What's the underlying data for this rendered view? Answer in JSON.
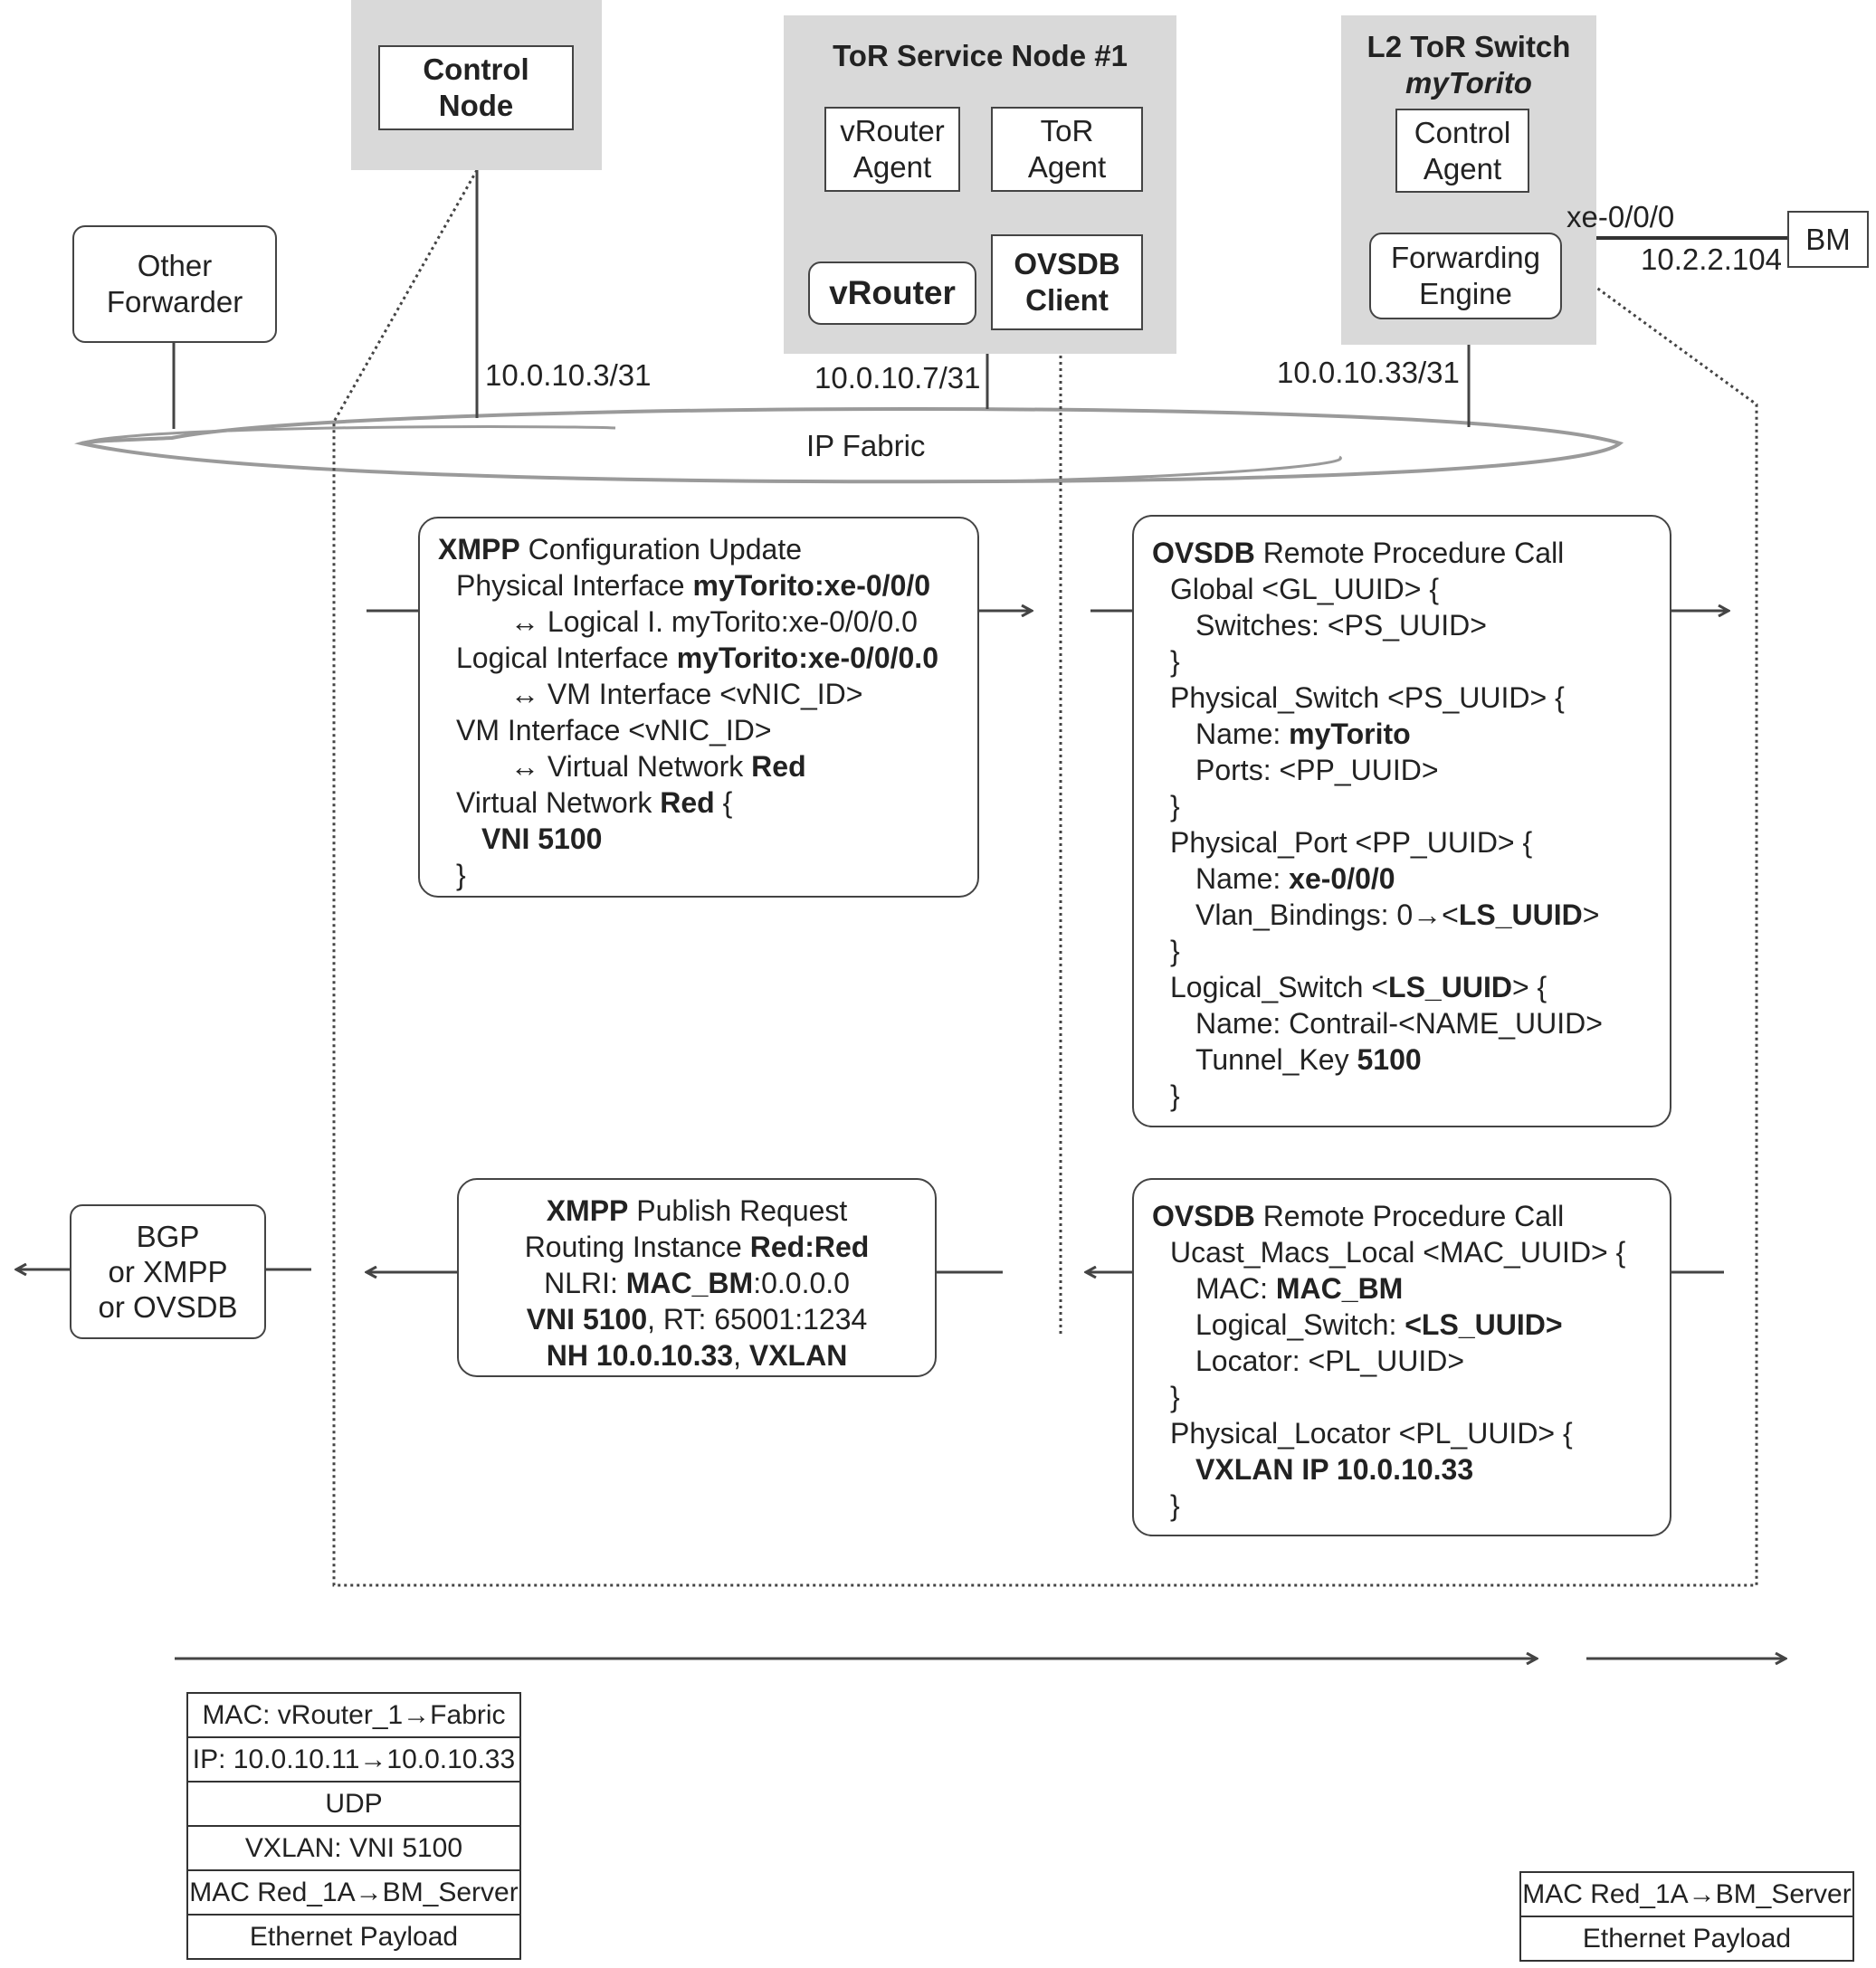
{
  "nodes": {
    "control_node": {
      "label_line1": "Control",
      "label_line2": "Node",
      "ip": "10.0.10.3/31"
    },
    "tor_service_node": {
      "title": "ToR Service Node #1",
      "vrouter_agent": {
        "line1": "vRouter",
        "line2": "Agent"
      },
      "tor_agent": {
        "line1": "ToR",
        "line2": "Agent"
      },
      "vrouter": "vRouter",
      "ovsdb_client": {
        "line1": "OVSDB",
        "line2": "Client"
      },
      "ip": "10.0.10.7/31"
    },
    "l2_tor_switch": {
      "title": "L2 ToR Switch",
      "subtitle": "myTorito",
      "control_agent": {
        "line1": "Control",
        "line2": "Agent"
      },
      "forwarding_engine": {
        "line1": "Forwarding",
        "line2": "Engine"
      },
      "ip": "10.0.10.33/31",
      "port": "xe-0/0/0"
    },
    "bm": {
      "label": "BM",
      "ip": "10.2.2.104"
    },
    "other_forwarder": {
      "line1": "Other",
      "line2": "Forwarder"
    },
    "ip_fabric": "IP Fabric",
    "bgp_box": {
      "line1": "BGP",
      "line2": "or XMPP",
      "line3": "or OVSDB"
    }
  },
  "messages": {
    "xmpp_config": {
      "header_bold": "XMPP",
      "header_rest": " Configuration Update",
      "lines": [
        {
          "indent": 1,
          "normal": "Physical Interface ",
          "bold": "myTorito:xe-0/0/0"
        },
        {
          "indent": 3,
          "normal": "↔ Logical I. myTorito:xe-0/0/0.0",
          "bold": ""
        },
        {
          "indent": 1,
          "normal": "Logical Interface ",
          "bold": "myTorito:xe-0/0/0.0"
        },
        {
          "indent": 3,
          "normal": "↔ VM Interface <vNIC_ID>",
          "bold": ""
        },
        {
          "indent": 1,
          "normal": "VM Interface <vNIC_ID>",
          "bold": ""
        },
        {
          "indent": 3,
          "normal": "↔ Virtual Network ",
          "bold": "Red"
        },
        {
          "indent": 1,
          "normal": "Virtual Network ",
          "bold": "Red",
          "after": " {"
        },
        {
          "indent": 2,
          "normal": "",
          "bold": "VNI 5100"
        },
        {
          "indent": 1,
          "normal": "}",
          "bold": ""
        }
      ]
    },
    "ovsdb_rpc_1": {
      "header_bold": "OVSDB",
      "header_rest": " Remote Procedure Call",
      "lines": [
        {
          "indent": 1,
          "normal": "Global <GL_UUID> {",
          "bold": ""
        },
        {
          "indent": 2,
          "normal": "Switches: <PS_UUID>",
          "bold": ""
        },
        {
          "indent": 1,
          "normal": "}",
          "bold": ""
        },
        {
          "indent": 1,
          "normal": "Physical_Switch <PS_UUID> {",
          "bold": ""
        },
        {
          "indent": 2,
          "normal": "Name: ",
          "bold": "myTorito"
        },
        {
          "indent": 2,
          "normal": "Ports: <PP_UUID>",
          "bold": ""
        },
        {
          "indent": 1,
          "normal": "}",
          "bold": ""
        },
        {
          "indent": 1,
          "normal": "Physical_Port <PP_UUID> {",
          "bold": ""
        },
        {
          "indent": 2,
          "normal": "Name: ",
          "bold": "xe-0/0/0"
        },
        {
          "indent": 2,
          "normal": "Vlan_Bindings: 0→<",
          "bold": "LS_UUID",
          "after": ">"
        },
        {
          "indent": 1,
          "normal": "}",
          "bold": ""
        },
        {
          "indent": 1,
          "normal": "Logical_Switch <",
          "bold": "LS_UUID",
          "after": "> {"
        },
        {
          "indent": 2,
          "normal": "Name: Contrail-<NAME_UUID>",
          "bold": ""
        },
        {
          "indent": 2,
          "normal": "Tunnel_Key ",
          "bold": "5100"
        },
        {
          "indent": 1,
          "normal": "}",
          "bold": ""
        }
      ]
    },
    "xmpp_publish": {
      "header_bold": "XMPP",
      "header_rest": " Publish Request",
      "lines": [
        {
          "normal": "Routing Instance ",
          "bold": "Red:Red"
        },
        {
          "normal": "NLRI: ",
          "bold": "MAC_BM",
          "after": ":0.0.0.0"
        },
        {
          "normal": "",
          "bold": "VNI 5100",
          "after": ", RT: 65001:1234"
        },
        {
          "normal": "",
          "bold": "NH 10.0.10.33",
          "after": ", ",
          "bold2": "VXLAN"
        }
      ]
    },
    "ovsdb_rpc_2": {
      "header_bold": "OVSDB",
      "header_rest": " Remote Procedure Call",
      "lines": [
        {
          "indent": 1,
          "normal": "Ucast_Macs_Local <MAC_UUID> {",
          "bold": ""
        },
        {
          "indent": 2,
          "normal": "MAC: ",
          "bold": "MAC_BM"
        },
        {
          "indent": 2,
          "normal": "Logical_Switch: ",
          "bold": "<LS_UUID>"
        },
        {
          "indent": 2,
          "normal": "Locator: <PL_UUID>",
          "bold": ""
        },
        {
          "indent": 1,
          "normal": "}",
          "bold": ""
        },
        {
          "indent": 1,
          "normal": "Physical_Locator <PL_UUID> {",
          "bold": ""
        },
        {
          "indent": 2,
          "normal": "",
          "bold": "VXLAN IP 10.0.10.33"
        },
        {
          "indent": 1,
          "normal": "}",
          "bold": ""
        }
      ]
    }
  },
  "packets": {
    "encapsulated": [
      "MAC: vRouter_1→Fabric",
      "IP: 10.0.10.11→10.0.10.33",
      "UDP",
      "VXLAN: VNI 5100",
      "MAC Red_1A→BM_Server",
      "Ethernet Payload"
    ],
    "decapsulated": [
      "MAC Red_1A→BM_Server",
      "Ethernet Payload"
    ]
  },
  "colors": {
    "panel_gray": "#d9d9d9",
    "line": "#444444",
    "cloud_stroke": "#9a9a9a"
  }
}
